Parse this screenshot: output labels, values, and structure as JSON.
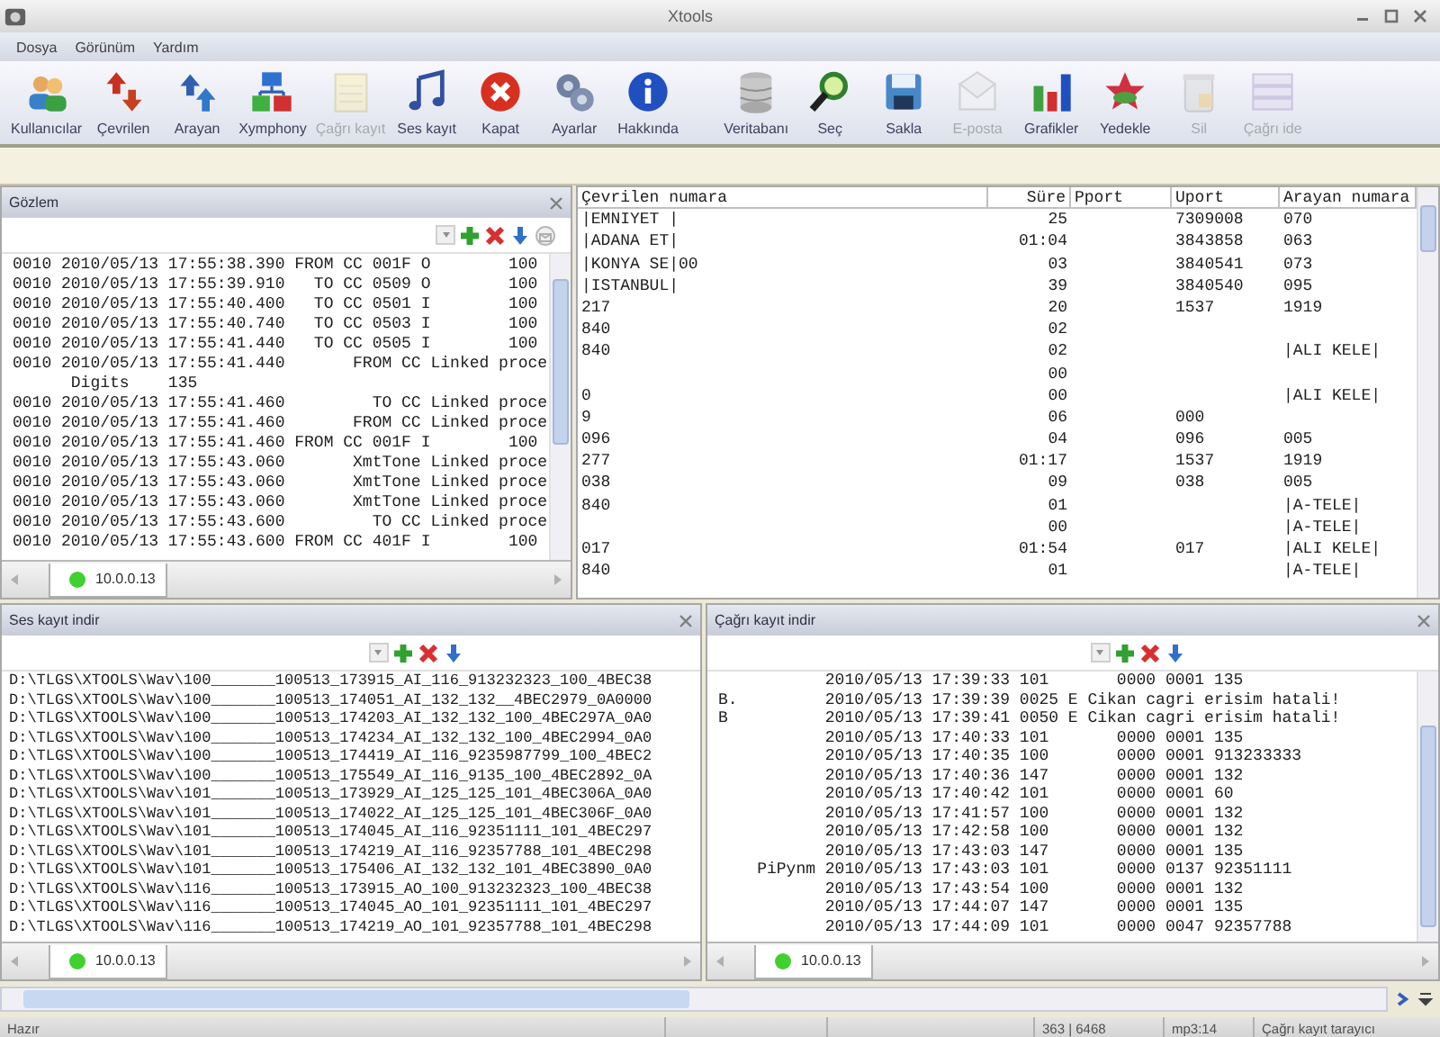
{
  "window": {
    "title": "Xtools"
  },
  "menu": [
    {
      "label": "Dosya"
    },
    {
      "label": "Görünüm"
    },
    {
      "label": "Yardım"
    }
  ],
  "toolbar": {
    "groups": [
      [
        {
          "label": "Kullanıcılar",
          "disabled": false
        },
        {
          "label": "Çevrilen",
          "disabled": false
        },
        {
          "label": "Arayan",
          "disabled": false
        },
        {
          "label": "Xymphony",
          "disabled": false
        },
        {
          "label": "Çağrı kayıt",
          "disabled": true
        },
        {
          "label": "Ses kayıt",
          "disabled": false
        },
        {
          "label": "Kapat",
          "disabled": false
        },
        {
          "label": "Ayarlar",
          "disabled": false
        },
        {
          "label": "Hakkında",
          "disabled": false
        }
      ],
      [
        {
          "label": "Veritabanı",
          "disabled": false
        },
        {
          "label": "Seç",
          "disabled": false
        },
        {
          "label": "Sakla",
          "disabled": false
        },
        {
          "label": "E-posta",
          "disabled": true
        },
        {
          "label": "Grafikler",
          "disabled": false
        },
        {
          "label": "Yedekle",
          "disabled": false
        },
        {
          "label": "Sil",
          "disabled": true
        },
        {
          "label": "Çağrı ide",
          "disabled": true
        }
      ]
    ]
  },
  "monitor_panel": {
    "title": "Gözlem",
    "tab": "10.0.0.13",
    "lines": [
      "0010 2010/05/13 17:55:38.390 FROM CC 001F O        100",
      "0010 2010/05/13 17:55:39.910   TO CC 0509 O        100",
      "0010 2010/05/13 17:55:40.400   TO CC 0501 I        100",
      "0010 2010/05/13 17:55:40.740   TO CC 0503 I        100",
      "0010 2010/05/13 17:55:41.440   TO CC 0505 I        100",
      "0010 2010/05/13 17:55:41.440       FROM CC Linked proce",
      "      Digits    135",
      "0010 2010/05/13 17:55:41.460         TO CC Linked proce",
      "0010 2010/05/13 17:55:41.460       FROM CC Linked proce",
      "0010 2010/05/13 17:55:41.460 FROM CC 001F I        100",
      "0010 2010/05/13 17:55:43.060       XmtTone Linked proce",
      "0010 2010/05/13 17:55:43.060       XmtTone Linked proce",
      "0010 2010/05/13 17:55:43.060       XmtTone Linked proce",
      "0010 2010/05/13 17:55:43.600         TO CC Linked proce",
      "0010 2010/05/13 17:55:43.600 FROM CC 401F I        100"
    ]
  },
  "calls_table": {
    "columns": [
      "Çevrilen numara",
      "Süre",
      "Pport",
      "Uport",
      "Arayan numara"
    ],
    "rows": [
      [
        "|EMNIYET |",
        "25",
        null,
        "7309008",
        "070"
      ],
      [
        "|ADANA ET|",
        "01:04",
        null,
        "3843858",
        "063"
      ],
      [
        "|KONYA SE|00",
        "03",
        null,
        "3840541",
        "073"
      ],
      [
        "|ISTANBUL|",
        "39",
        null,
        "3840540",
        "095"
      ],
      [
        "217",
        "20",
        null,
        "1537",
        "1919"
      ],
      [
        "840",
        "02",
        null,
        null,
        null
      ],
      [
        "840",
        "02",
        null,
        null,
        "|ALI KELE|"
      ],
      [
        null,
        "00",
        null,
        null,
        null
      ],
      [
        "0",
        "00",
        null,
        null,
        "|ALI KELE|"
      ],
      [
        "9",
        "06",
        null,
        "000",
        null
      ],
      [
        "096",
        "04",
        null,
        "096",
        "005"
      ],
      [
        "277",
        "01:17",
        null,
        "1537",
        "1919"
      ],
      [
        "038",
        "09",
        null,
        "038",
        "005"
      ],
      [
        "840",
        "01",
        null,
        null,
        "|A-TELE|"
      ],
      [
        null,
        "00",
        null,
        null,
        "|A-TELE|"
      ],
      [
        "017",
        "01:54",
        null,
        "017",
        "|ALI KELE|"
      ],
      [
        "840",
        "01",
        null,
        null,
        "|A-TELE|"
      ]
    ]
  },
  "voice_panel": {
    "title": "Ses kayıt indir",
    "tab": "10.0.0.13",
    "lines": [
      "D:\\TLGS\\XTOOLS\\Wav\\100_______100513_173915_AI_116_913232323_100_4BEC38",
      "D:\\TLGS\\XTOOLS\\Wav\\100_______100513_174051_AI_132_132__4BEC2979_0A0000",
      "D:\\TLGS\\XTOOLS\\Wav\\100_______100513_174203_AI_132_132_100_4BEC297A_0A0",
      "D:\\TLGS\\XTOOLS\\Wav\\100_______100513_174234_AI_132_132_100_4BEC2994_0A0",
      "D:\\TLGS\\XTOOLS\\Wav\\100_______100513_174419_AI_116_9235987799_100_4BEC2",
      "D:\\TLGS\\XTOOLS\\Wav\\100_______100513_175549_AI_116_9135_100_4BEC2892_0A",
      "D:\\TLGS\\XTOOLS\\Wav\\101_______100513_173929_AI_125_125_101_4BEC306A_0A0",
      "D:\\TLGS\\XTOOLS\\Wav\\101_______100513_174022_AI_125_125_101_4BEC306F_0A0",
      "D:\\TLGS\\XTOOLS\\Wav\\101_______100513_174045_AI_116_92351111_101_4BEC297",
      "D:\\TLGS\\XTOOLS\\Wav\\101_______100513_174219_AI_116_92357788_101_4BEC298",
      "D:\\TLGS\\XTOOLS\\Wav\\101_______100513_175406_AI_132_132_101_4BEC3890_0A0",
      "D:\\TLGS\\XTOOLS\\Wav\\116_______100513_173915_AO_100_913232323_100_4BEC38",
      "D:\\TLGS\\XTOOLS\\Wav\\116_______100513_174045_AO_101_92351111_101_4BEC297",
      "D:\\TLGS\\XTOOLS\\Wav\\116_______100513_174219_AO_101_92357788_101_4BEC298"
    ]
  },
  "call_log_panel": {
    "title": "Çağrı kayıt indir",
    "tab": "10.0.0.13",
    "lines": [
      "           2010/05/13 17:39:33 101       0000 0001 135",
      "B.         2010/05/13 17:39:39 0025 E Cikan cagri erisim hatali!",
      "B          2010/05/13 17:39:41 0050 E Cikan cagri erisim hatali!",
      "           2010/05/13 17:40:33 101       0000 0001 135",
      "           2010/05/13 17:40:35 100       0000 0001 913233333",
      "           2010/05/13 17:40:36 147       0000 0001 132",
      "           2010/05/13 17:40:42 101       0000 0001 60",
      "           2010/05/13 17:41:57 100       0000 0001 132",
      "           2010/05/13 17:42:58 100       0000 0001 132",
      "           2010/05/13 17:43:03 147       0000 0001 135",
      "    PiPynm 2010/05/13 17:43:03 101       0000 0137 92351111",
      "           2010/05/13 17:43:54 100       0000 0001 132",
      "           2010/05/13 17:44:07 147       0000 0001 135",
      "           2010/05/13 17:44:09 101       0000 0047 92357788"
    ]
  },
  "status_bar": {
    "message": "Hazır",
    "count": "363 | 6468",
    "format": "mp3:14",
    "mode": "Çağrı kayıt tarayıcı"
  }
}
